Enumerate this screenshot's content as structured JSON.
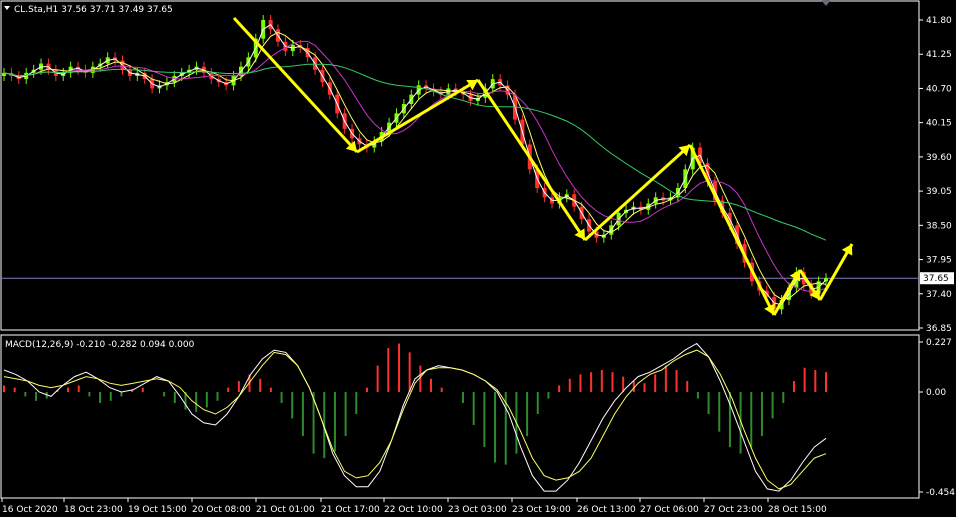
{
  "chart_data": [
    {
      "type": "candlestick",
      "title": "CL.Sta,H1  37.56 37.71 37.49 37.65",
      "symbol": "CL.Sta,H1",
      "ohlc": {
        "open": 37.56,
        "high": 37.71,
        "low": 37.49,
        "close": 37.65
      },
      "ylim": [
        36.8,
        42.0
      ],
      "yticks": [
        "41.80",
        "41.25",
        "40.70",
        "40.15",
        "39.60",
        "39.05",
        "38.50",
        "37.95",
        "37.40",
        "36.85"
      ],
      "ytick_values": [
        41.8,
        41.25,
        40.7,
        40.15,
        39.6,
        39.05,
        38.5,
        37.95,
        37.4,
        36.85
      ],
      "current_price": "37.65",
      "current_price_value": 37.65,
      "colors": {
        "up": "#7CFC00",
        "down": "#FF3030",
        "ma_fast": "#FFFFFF",
        "ma_mid": "#FFFF66",
        "ma_slow": "#CC33CC",
        "ma_long": "#33CC66",
        "arrow": "#FFFF00",
        "price_line": "#8080C0"
      },
      "close_series": [
        40.95,
        40.9,
        40.85,
        40.95,
        41.0,
        41.1,
        41.0,
        40.9,
        40.95,
        41.05,
        41.0,
        40.95,
        41.05,
        41.1,
        41.2,
        41.15,
        41.0,
        40.9,
        40.95,
        40.85,
        40.7,
        40.75,
        40.8,
        40.9,
        40.95,
        41.0,
        41.05,
        40.95,
        40.85,
        40.8,
        40.75,
        40.9,
        41.05,
        41.2,
        41.5,
        41.8,
        41.65,
        41.45,
        41.3,
        41.4,
        41.35,
        41.2,
        41.0,
        40.8,
        40.6,
        40.3,
        40.05,
        39.9,
        39.8,
        39.75,
        39.85,
        40.0,
        40.15,
        40.3,
        40.45,
        40.6,
        40.75,
        40.7,
        40.65,
        40.6,
        40.7,
        40.65,
        40.6,
        40.5,
        40.55,
        40.7,
        40.85,
        40.75,
        40.6,
        40.2,
        39.8,
        39.4,
        39.1,
        38.95,
        38.85,
        38.95,
        39.0,
        38.8,
        38.6,
        38.4,
        38.3,
        38.35,
        38.5,
        38.7,
        38.75,
        38.8,
        38.75,
        38.85,
        38.95,
        38.9,
        38.95,
        39.1,
        39.4,
        39.75,
        39.5,
        39.2,
        38.9,
        38.7,
        38.5,
        38.2,
        37.9,
        37.6,
        37.45,
        37.35,
        37.15,
        37.3,
        37.5,
        37.75,
        37.55,
        37.4,
        37.6,
        37.65
      ],
      "x_first_pixel_unused": null,
      "xticks": [
        "16 Oct 2020",
        "18 Oct 23:00",
        "19 Oct 15:00",
        "20 Oct 08:00",
        "21 Oct 01:00",
        "21 Oct 17:00",
        "22 Oct 10:00",
        "23 Oct 03:00",
        "23 Oct 19:00",
        "26 Oct 13:00",
        "27 Oct 06:00",
        "27 Oct 23:00",
        "28 Oct 15:00"
      ],
      "trend_arrows": [
        [
          [
            41.8,
            "21 Oct 01:00"
          ],
          [
            39.7,
            "21 Oct 17:00"
          ]
        ],
        [
          [
            39.7,
            "21 Oct 17:00"
          ],
          [
            40.85,
            "23 Oct 03:00"
          ]
        ],
        [
          [
            40.85,
            "23 Oct 03:00"
          ],
          [
            38.3,
            "26 Oct 13:00"
          ]
        ],
        [
          [
            38.3,
            "26 Oct 13:00"
          ],
          [
            39.75,
            "27 Oct 06:00"
          ]
        ],
        [
          [
            39.75,
            "27 Oct 06:00"
          ],
          [
            37.15,
            "28 Oct 15:00"
          ]
        ]
      ]
    },
    {
      "type": "bar",
      "title": "MACD(12,26,9) -0.210 -0.282 0.094 0.000",
      "ylim": [
        -0.454,
        0.227
      ],
      "yticks": [
        "0.227",
        "0.00",
        "-0.454"
      ],
      "ytick_values": [
        0.227,
        0.0,
        -0.454
      ],
      "histogram": [
        0.03,
        0.02,
        -0.02,
        -0.04,
        -0.03,
        0.01,
        0.02,
        0.03,
        -0.02,
        -0.05,
        -0.04,
        -0.02,
        0.01,
        0.02,
        0.0,
        -0.02,
        -0.05,
        -0.08,
        -0.09,
        -0.07,
        -0.04,
        0.02,
        0.05,
        0.08,
        0.06,
        0.02,
        -0.05,
        -0.12,
        -0.2,
        -0.28,
        -0.3,
        -0.27,
        -0.2,
        -0.1,
        0.02,
        0.12,
        0.2,
        0.22,
        0.18,
        0.12,
        0.06,
        0.02,
        0.0,
        -0.05,
        -0.15,
        -0.25,
        -0.32,
        -0.33,
        -0.28,
        -0.2,
        -0.1,
        -0.03,
        0.03,
        0.06,
        0.08,
        0.09,
        0.1,
        0.09,
        0.07,
        0.05,
        0.04,
        0.08,
        0.12,
        0.1,
        0.05,
        -0.03,
        -0.1,
        -0.18,
        -0.25,
        -0.28,
        -0.25,
        -0.2,
        -0.12,
        -0.05,
        0.05,
        0.11,
        0.1,
        0.09
      ],
      "macd_line": [
        0.1,
        0.08,
        0.05,
        0.0,
        -0.02,
        0.03,
        0.07,
        0.09,
        0.06,
        0.02,
        0.0,
        0.01,
        0.04,
        0.07,
        0.05,
        -0.02,
        -0.1,
        -0.14,
        -0.15,
        -0.1,
        -0.02,
        0.08,
        0.15,
        0.19,
        0.18,
        0.12,
        0.02,
        -0.12,
        -0.28,
        -0.38,
        -0.43,
        -0.43,
        -0.36,
        -0.22,
        -0.06,
        0.06,
        0.1,
        0.12,
        0.11,
        0.1,
        0.08,
        0.05,
        0.0,
        -0.1,
        -0.25,
        -0.38,
        -0.45,
        -0.45,
        -0.4,
        -0.32,
        -0.22,
        -0.12,
        -0.04,
        0.02,
        0.07,
        0.09,
        0.12,
        0.15,
        0.19,
        0.22,
        0.16,
        0.05,
        -0.08,
        -0.22,
        -0.36,
        -0.44,
        -0.45,
        -0.4,
        -0.32,
        -0.25,
        -0.21
      ],
      "signal_line": [
        0.07,
        0.06,
        0.05,
        0.03,
        0.02,
        0.03,
        0.05,
        0.07,
        0.06,
        0.04,
        0.03,
        0.04,
        0.05,
        0.06,
        0.05,
        0.02,
        -0.04,
        -0.08,
        -0.1,
        -0.07,
        -0.02,
        0.05,
        0.12,
        0.18,
        0.17,
        0.12,
        0.02,
        -0.12,
        -0.26,
        -0.36,
        -0.39,
        -0.38,
        -0.32,
        -0.22,
        -0.08,
        0.04,
        0.1,
        0.11,
        0.11,
        0.1,
        0.08,
        0.05,
        0.01,
        -0.07,
        -0.18,
        -0.3,
        -0.38,
        -0.4,
        -0.39,
        -0.36,
        -0.3,
        -0.2,
        -0.1,
        -0.02,
        0.04,
        0.08,
        0.1,
        0.14,
        0.17,
        0.19,
        0.16,
        0.08,
        -0.03,
        -0.17,
        -0.3,
        -0.4,
        -0.44,
        -0.42,
        -0.36,
        -0.3,
        -0.28
      ],
      "colors": {
        "pos": "#FF3030",
        "neg": "#2E8B2E",
        "macd": "#FFFFFF",
        "signal": "#FFFF66"
      }
    }
  ]
}
